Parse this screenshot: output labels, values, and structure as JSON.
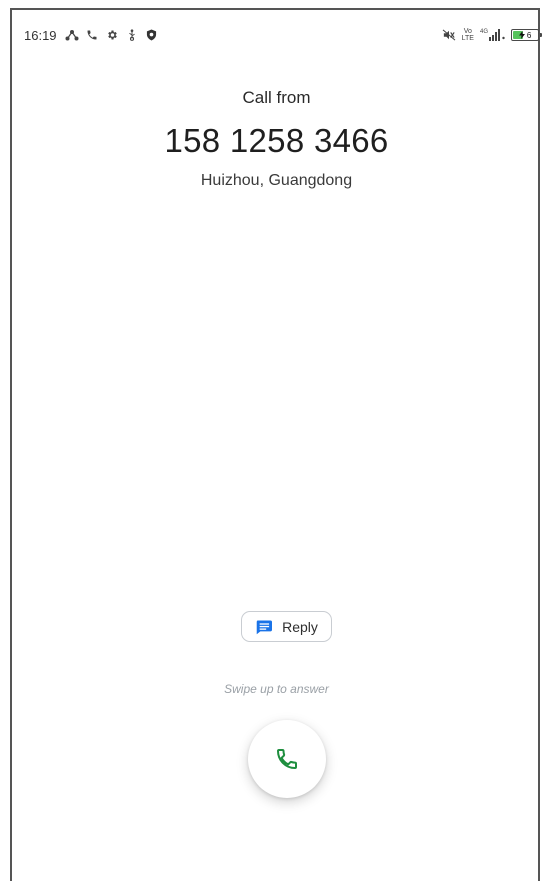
{
  "status_bar": {
    "time": "16:19",
    "left_icons": [
      "network-icon",
      "phone-icon",
      "settings-icon",
      "usb-icon",
      "shield-icon"
    ],
    "volte_top": "Vo",
    "volte_bottom": "LTE",
    "signal_label": "4G",
    "battery_level": "6"
  },
  "call": {
    "from_label": "Call from",
    "number": "158 1258 3466",
    "location": "Huizhou, Guangdong"
  },
  "actions": {
    "reply_label": "Reply",
    "swipe_hint": "Swipe up to answer"
  },
  "colors": {
    "answer_icon": "#1e8e3e",
    "reply_icon": "#1a73e8",
    "battery_fill": "#56c35c"
  }
}
